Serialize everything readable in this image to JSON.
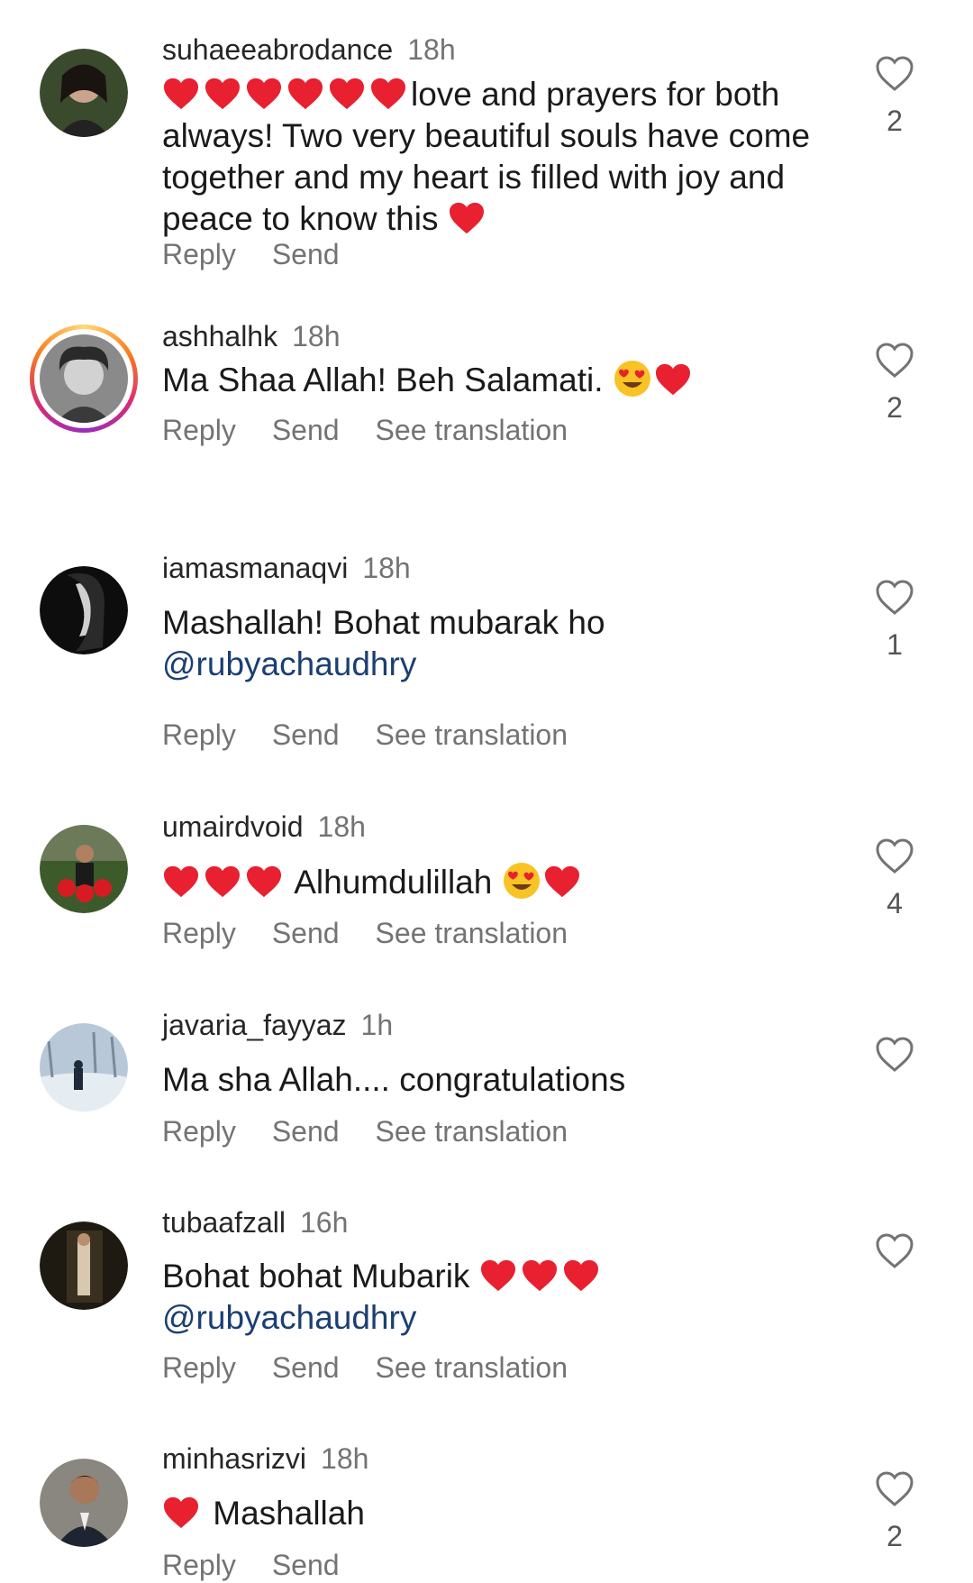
{
  "comments": [
    {
      "username": "suhaeeabrodance",
      "time": "18h",
      "text_lines": [
        "love and prayers for both",
        "always! Two very beautiful souls have come",
        "together and my heart is filled with joy and",
        "peace to know this"
      ],
      "likes": "2",
      "reply": "Reply",
      "send": "Send"
    },
    {
      "username": "ashhalhk",
      "time": "18h",
      "text": "Ma Shaa Allah! Beh Salamati.",
      "likes": "2",
      "reply": "Reply",
      "send": "Send",
      "translate": "See translation"
    },
    {
      "username": "iamasmanaqvi",
      "time": "18h",
      "text": "Mashallah! Bohat mubarak ho",
      "mention": "@rubyachaudhry",
      "likes": "1",
      "reply": "Reply",
      "send": "Send",
      "translate": "See translation"
    },
    {
      "username": "umairdvoid",
      "time": "18h",
      "text": "Alhumdulillah",
      "likes": "4",
      "reply": "Reply",
      "send": "Send",
      "translate": "See translation"
    },
    {
      "username": "javaria_fayyaz",
      "time": "1h",
      "text": "Ma sha Allah.... congratulations",
      "reply": "Reply",
      "send": "Send",
      "translate": "See translation"
    },
    {
      "username": "tubaafzall",
      "time": "16h",
      "text": "Bohat bohat Mubarik",
      "mention": "@rubyachaudhry",
      "reply": "Reply",
      "send": "Send",
      "translate": "See translation"
    },
    {
      "username": "minhasrizvi",
      "time": "18h",
      "text": "Mashallah",
      "likes": "2",
      "reply": "Reply",
      "send": "Send"
    }
  ],
  "colors": {
    "heart": "#e8202f",
    "mention": "#1b3f73",
    "muted": "#737373"
  },
  "icons": {
    "like": "heart-outline-icon",
    "emoji_heart": "red-heart-emoji",
    "emoji_face": "heart-eyes-emoji"
  }
}
